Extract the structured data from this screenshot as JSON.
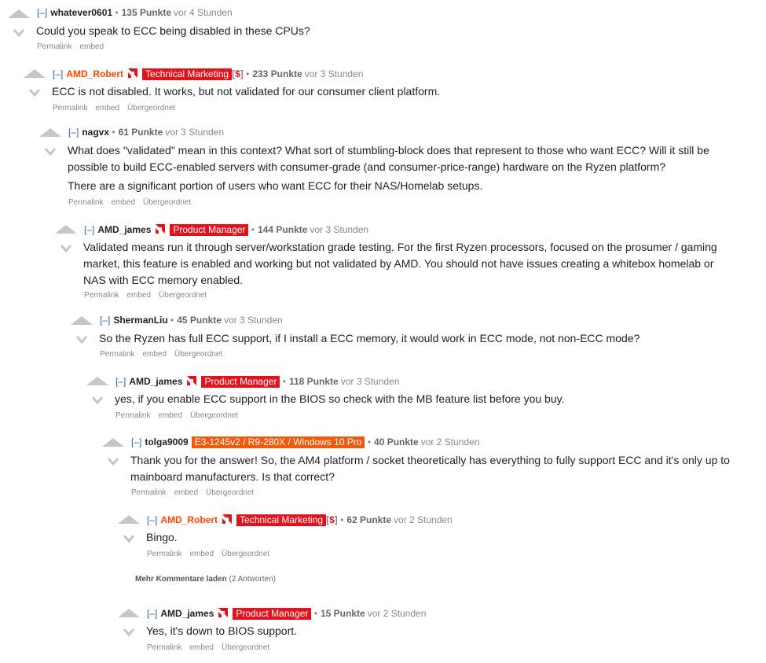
{
  "actions": {
    "permalink": "Permalink",
    "embed": "embed",
    "parent": "Übergeordnet"
  },
  "toggle": "[–]",
  "comments": [
    {
      "author": "whatever0601",
      "score": "135 Punkte",
      "time": "vor 4 Stunden",
      "lines": [
        "Could you speak to ECC being disabled in these CPUs?"
      ]
    },
    {
      "author": "AMD_Robert",
      "flair": "Technical Marketing",
      "dollar": "$",
      "score": "233 Punkte",
      "time": "vor 3 Stunden",
      "lines": [
        "ECC is not disabled. It works, but not validated for our consumer client platform."
      ]
    },
    {
      "author": "nagvx",
      "score": "61 Punkte",
      "time": "vor 3 Stunden",
      "lines": [
        "What does \"validated\" mean in this context? What sort of stumbling-block does that represent to those who want ECC? Will it still be",
        "possible to build ECC-enabled servers with consumer-grade (and consumer-price-range) hardware on the Ryzen platform?",
        "There are a significant portion of users who want ECC for their NAS/Homelab setups."
      ]
    },
    {
      "author": "AMD_james",
      "flair": "Product Manager",
      "score": "144 Punkte",
      "time": "vor 3 Stunden",
      "lines": [
        "Validated means run it through server/workstation grade testing. For the first Ryzen processors, focused on the prosumer / gaming",
        "market, this feature is enabled and working but not validated by AMD. You should not have issues creating a whitebox homelab or",
        "NAS with ECC memory enabled."
      ]
    },
    {
      "author": "ShermanLiu",
      "score": "45 Punkte",
      "time": "vor 3 Stunden",
      "lines": [
        "So the Ryzen has full ECC support, if I install a ECC memory, it would work in ECC mode, not non-ECC mode?"
      ]
    },
    {
      "author": "AMD_james",
      "flair": "Product Manager",
      "score": "118 Punkte",
      "time": "vor 3 Stunden",
      "lines": [
        "yes, if you enable ECC support in the BIOS so check with the MB feature list before you buy."
      ]
    },
    {
      "author": "tolga9009",
      "flair": "E3-1245v2 / R9-280X / Windows 10 Pro",
      "score": "40 Punkte",
      "time": "vor 2 Stunden",
      "lines": [
        "Thank you for the answer! So, the AM4 platform / socket theoretically has everything to fully support ECC and it's only up to",
        "mainboard manufacturers. Is that correct?"
      ]
    },
    {
      "author": "AMD_Robert",
      "flair": "Technical Marketing",
      "dollar": "$",
      "score": "62 Punkte",
      "time": "vor 2 Stunden",
      "lines": [
        "Bingo."
      ]
    },
    {
      "author": "AMD_james",
      "flair": "Product Manager",
      "score": "15 Punkte",
      "time": "vor 2 Stunden",
      "lines": [
        "Yes, it's down to BIOS support."
      ]
    }
  ],
  "more_comments": {
    "label": "Mehr Kommentare laden",
    "count": "(2 Antworten)"
  },
  "colors": {
    "flair_red": "#e4121d",
    "flair_orange": "#f2590d",
    "admin_author": "#ff4500",
    "vote_arrow": "#c6c6c6"
  }
}
